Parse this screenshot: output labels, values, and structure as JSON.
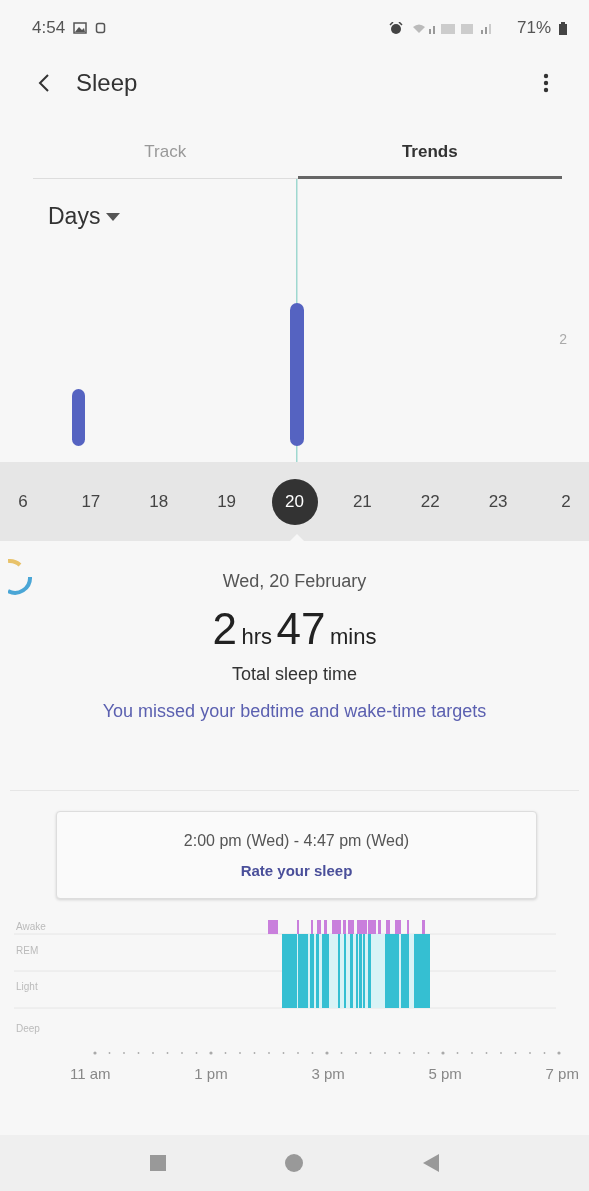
{
  "status_bar": {
    "time": "4:54",
    "battery": "71%"
  },
  "app_bar": {
    "title": "Sleep"
  },
  "tabs": [
    {
      "label": "Track",
      "selected": false
    },
    {
      "label": "Trends",
      "selected": true
    }
  ],
  "period": {
    "label": "Days"
  },
  "chart": {
    "tick_label": "2"
  },
  "dates": [
    {
      "label": "6",
      "selected": false
    },
    {
      "label": "17",
      "selected": false
    },
    {
      "label": "18",
      "selected": false
    },
    {
      "label": "19",
      "selected": false
    },
    {
      "label": "20",
      "selected": true
    },
    {
      "label": "21",
      "selected": false
    },
    {
      "label": "22",
      "selected": false
    },
    {
      "label": "23",
      "selected": false
    },
    {
      "label": "2",
      "selected": false
    }
  ],
  "summary": {
    "date": "Wed, 20 February",
    "hours": "2",
    "hours_unit": "hrs",
    "minutes": "47",
    "minutes_unit": "mins",
    "caption": "Total sleep time",
    "message": "You missed your bedtime and wake-time targets"
  },
  "session": {
    "range": "2:00 pm (Wed) - 4:47 pm (Wed)",
    "action": "Rate your sleep"
  },
  "stages": [
    "Awake",
    "REM",
    "Light",
    "Deep"
  ],
  "time_axis": [
    "11 am",
    "1 pm",
    "3 pm",
    "5 pm",
    "7 pm"
  ]
}
